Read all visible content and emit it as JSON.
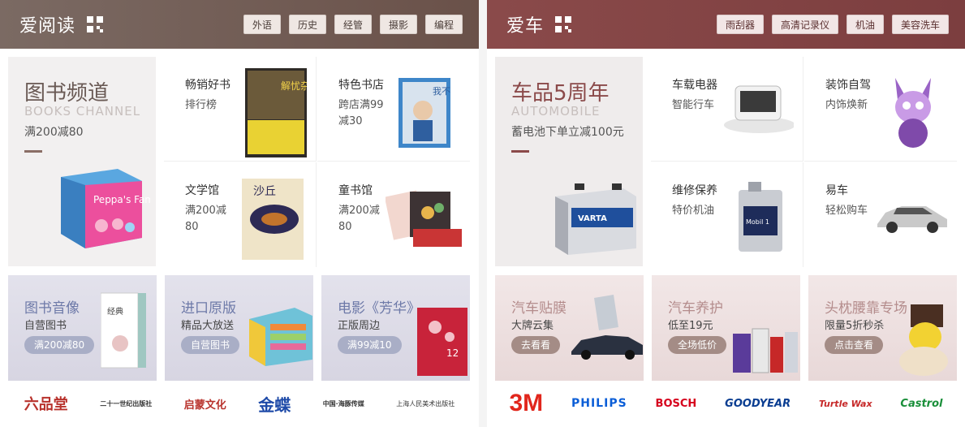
{
  "left": {
    "title": "爱阅读",
    "tags": [
      "外语",
      "历史",
      "经管",
      "摄影",
      "编程"
    ],
    "channel": {
      "title": "图书频道",
      "en": "BOOKS CHANNEL",
      "sub": "满200减80",
      "book_title": "Peppa's Family"
    },
    "cells": [
      {
        "t1": "畅销好书",
        "t2": "排行榜",
        "cover": "解忧杂货店"
      },
      {
        "t1": "特色书店",
        "t2": "跨店满99减30",
        "cover": "我不"
      },
      {
        "t1": "文学馆",
        "t2": "满200减80",
        "cover": "沙丘"
      },
      {
        "t1": "童书馆",
        "t2": "满200减80",
        "cover": ""
      }
    ],
    "promos": [
      {
        "title": "图书音像",
        "sub": "自营图书",
        "btn": "满200减80"
      },
      {
        "title": "进口原版",
        "sub": "精品大放送",
        "btn": "自营图书"
      },
      {
        "title": "电影《芳华》",
        "sub": "正版周边",
        "btn": "满99减10"
      }
    ],
    "brands": [
      "六品堂",
      "二十一世纪出版社",
      "启蒙文化",
      "金蝶",
      "中国·海豚传媒",
      "上海人民美术出版社"
    ]
  },
  "right": {
    "title": "爱车",
    "tags": [
      "雨刮器",
      "高清记录仪",
      "机油",
      "美容洗车"
    ],
    "channel": {
      "title": "车品5周年",
      "en": "AUTOMOBILE",
      "sub": "蓄电池下单立减100元",
      "battery_label": "VARTA"
    },
    "cells": [
      {
        "t1": "车载电器",
        "t2": "智能行车"
      },
      {
        "t1": "装饰自驾",
        "t2": "内饰焕新"
      },
      {
        "t1": "维修保养",
        "t2": "特价机油",
        "oil_label": "Mobil 1"
      },
      {
        "t1": "易车",
        "t2": "轻松购车"
      }
    ],
    "promos": [
      {
        "title": "汽车贴膜",
        "sub": "大牌云集",
        "btn": "去看看"
      },
      {
        "title": "汽车养护",
        "sub": "低至19元",
        "btn": "全场低价"
      },
      {
        "title": "头枕腰靠专场",
        "sub": "限量5折秒杀",
        "btn": "点击查看"
      }
    ],
    "brands": [
      "3M",
      "PHILIPS",
      "BOSCH",
      "GOODYEAR",
      "Turtle Wax",
      "Castrol"
    ]
  },
  "colors": {
    "left_header": "#6a5149",
    "right_header": "#7c3e3f",
    "brand_3m": "#e1261c",
    "brand_philips": "#0b5ed7",
    "brand_bosch": "#d6001c",
    "brand_goodyear": "#0a3d91",
    "brand_castrol": "#1a8f3a"
  }
}
